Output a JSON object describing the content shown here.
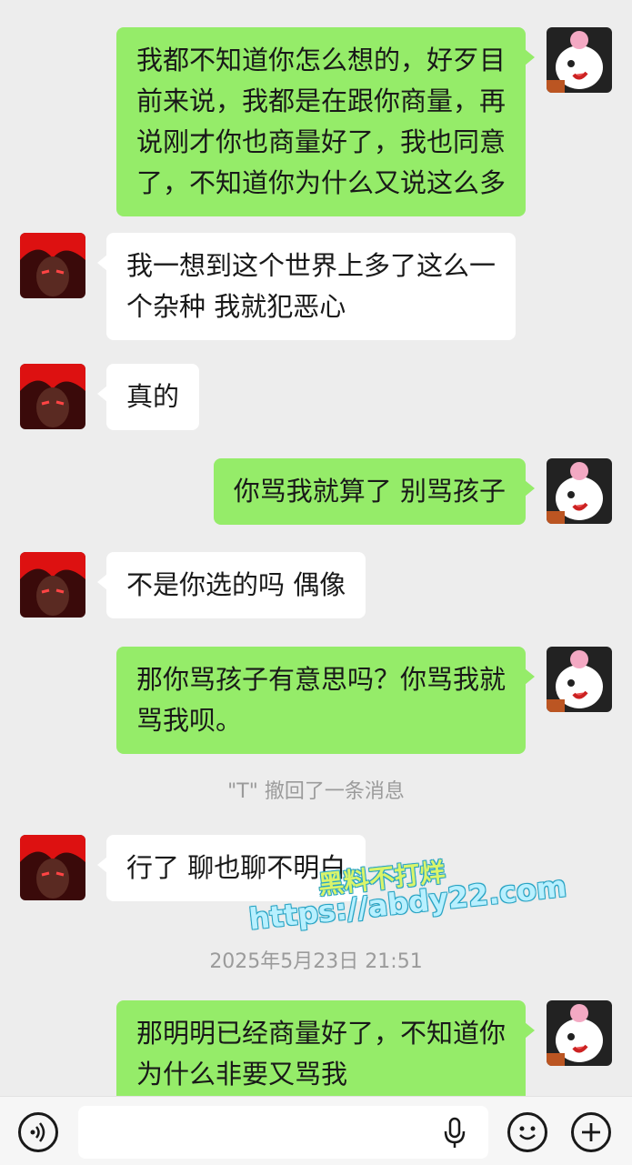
{
  "messages": [
    {
      "from": "self",
      "text": "我都不知道你怎么想的，好歹目\n前来说，我都是在跟你商量，再\n说刚才你也商量好了，我也同意\n了，不知道你为什么又说这么多"
    },
    {
      "from": "other",
      "text": "我一想到这个世界上多了这么一\n个杂种 我就犯恶心"
    },
    {
      "from": "other",
      "text": "真的"
    },
    {
      "from": "self",
      "text": "你骂我就算了 别骂孩子"
    },
    {
      "from": "other",
      "text": "不是你选的吗 偶像"
    },
    {
      "from": "self",
      "text": "那你骂孩子有意思吗？你骂我就\n骂我呗。"
    },
    {
      "system": "\"T\" 撤回了一条消息"
    },
    {
      "from": "other",
      "text": "行了 聊也聊不明白"
    },
    {
      "timestamp": "2025年5月23日 21:51"
    },
    {
      "from": "self",
      "text": "那明明已经商量好了，不知道你\n为什么非要又骂我"
    }
  ],
  "watermark": {
    "line1": "黑料不打烊",
    "line2": "https://abdy22.com"
  },
  "colors": {
    "self_bubble": "#95ec69",
    "other_bubble": "#ffffff",
    "background": "#ededed"
  },
  "icons": [
    "voice-icon",
    "microphone-icon",
    "emoji-icon",
    "add-icon"
  ]
}
